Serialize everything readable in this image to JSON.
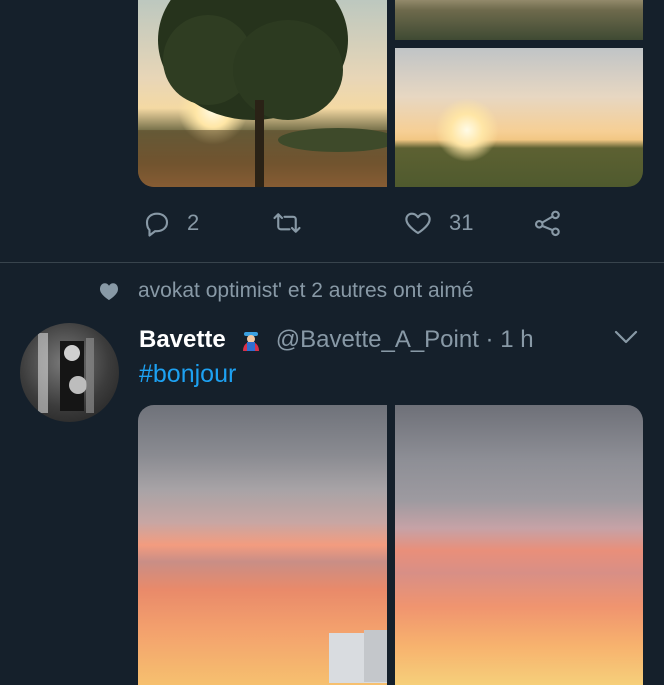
{
  "top_tweet": {
    "actions": {
      "reply_count": "2",
      "retweet_count": "",
      "like_count": "31"
    }
  },
  "social_context": {
    "text": "avokat optimist' et 2 autres ont aimé"
  },
  "tweet": {
    "author_name": "Bavette",
    "handle": "@Bavette_A_Point",
    "separator": "·",
    "time": "1 h",
    "text": "#bonjour"
  },
  "icons": {
    "reply": "reply-icon",
    "retweet": "retweet-icon",
    "like": "heart-icon",
    "share": "share-icon",
    "more": "chevron-down-icon",
    "badge": "emoji-badge-icon"
  },
  "colors": {
    "background": "#15202b",
    "secondary_text": "#8899a6",
    "link": "#1da1f2",
    "divider": "#38444d"
  }
}
